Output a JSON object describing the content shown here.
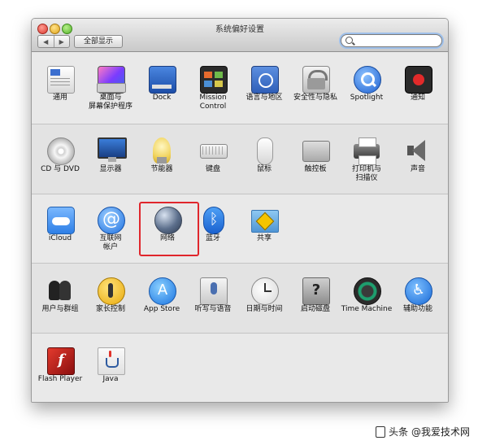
{
  "window": {
    "title": "系统偏好设置",
    "nav_back": "◀",
    "nav_forward": "▶",
    "show_all_label": "全部显示",
    "search_value": ""
  },
  "rows": [
    {
      "items": [
        {
          "id": "general",
          "label": "通用",
          "icon": "general-icon"
        },
        {
          "id": "desktop",
          "label": "桌面与\n屏幕保护程序",
          "icon": "desktop-icon"
        },
        {
          "id": "dock",
          "label": "Dock",
          "icon": "dock-icon"
        },
        {
          "id": "mission",
          "label": "Mission\nControl",
          "icon": "mission-control-icon"
        },
        {
          "id": "language",
          "label": "语言与地区",
          "icon": "flag-icon"
        },
        {
          "id": "security",
          "label": "安全性与隐私",
          "icon": "house-lock-icon"
        },
        {
          "id": "spotlight",
          "label": "Spotlight",
          "icon": "magnifier-icon"
        },
        {
          "id": "notifications",
          "label": "通知",
          "icon": "notifications-icon"
        }
      ]
    },
    {
      "items": [
        {
          "id": "cddvd",
          "label": "CD 与 DVD",
          "icon": "disc-icon"
        },
        {
          "id": "displays",
          "label": "显示器",
          "icon": "monitor-icon"
        },
        {
          "id": "energy",
          "label": "节能器",
          "icon": "lightbulb-icon"
        },
        {
          "id": "keyboard",
          "label": "键盘",
          "icon": "keyboard-icon"
        },
        {
          "id": "mouse",
          "label": "鼠标",
          "icon": "mouse-icon"
        },
        {
          "id": "trackpad",
          "label": "触控板",
          "icon": "trackpad-icon"
        },
        {
          "id": "printers",
          "label": "打印机与\n扫描仪",
          "icon": "printer-icon"
        },
        {
          "id": "sound",
          "label": "声音",
          "icon": "speaker-icon"
        }
      ]
    },
    {
      "items": [
        {
          "id": "icloud",
          "label": "iCloud",
          "icon": "cloud-icon"
        },
        {
          "id": "internet",
          "label": "互联网\n帐户",
          "icon": "at-icon"
        },
        {
          "id": "network",
          "label": "网络",
          "icon": "globe-icon"
        },
        {
          "id": "bluetooth",
          "label": "蓝牙",
          "icon": "bluetooth-icon"
        },
        {
          "id": "sharing",
          "label": "共享",
          "icon": "folder-icon"
        }
      ]
    },
    {
      "items": [
        {
          "id": "users",
          "label": "用户与群组",
          "icon": "users-icon"
        },
        {
          "id": "parental",
          "label": "家长控制",
          "icon": "parental-icon"
        },
        {
          "id": "appstore",
          "label": "App Store",
          "icon": "appstore-icon"
        },
        {
          "id": "dictation",
          "label": "听写与语音",
          "icon": "microphone-icon"
        },
        {
          "id": "datetime",
          "label": "日期与时间",
          "icon": "clock-icon"
        },
        {
          "id": "startup",
          "label": "启动磁盘",
          "icon": "disk-icon"
        },
        {
          "id": "timemachine",
          "label": "Time Machine",
          "icon": "time-machine-icon"
        },
        {
          "id": "accessibility",
          "label": "辅助功能",
          "icon": "accessibility-icon"
        }
      ]
    },
    {
      "items": [
        {
          "id": "flash",
          "label": "Flash Player",
          "icon": "flash-icon"
        },
        {
          "id": "java",
          "label": "Java",
          "icon": "java-icon"
        }
      ]
    }
  ],
  "glyphs": {
    "internet": "@",
    "bluetooth": "ᛒ",
    "appstore": "A",
    "startup": "?",
    "accessibility": "♿",
    "flash": "f"
  },
  "highlighted_item": "network",
  "highlight_color": "#e0262c",
  "watermark": "头条 @我爱技术网"
}
